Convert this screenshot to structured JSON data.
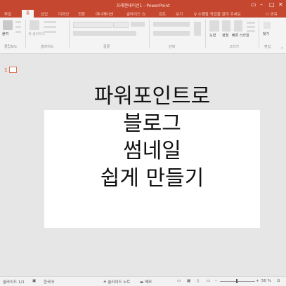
{
  "window": {
    "title": "프레젠테이션1 - PowerPoint"
  },
  "tabs": [
    "파일",
    "홈",
    "삽입",
    "디자인",
    "전환",
    "애니메이션",
    "슬라이드 쇼",
    "검토",
    "보기",
    "수행할 작업을 알려 주세요",
    "공유"
  ],
  "ribbon": {
    "paste_label": "붙여",
    "new_slide_label": "새 슬라이드",
    "groups": [
      "클립보드",
      "슬라이드",
      "글꼴",
      "단락",
      "그리기",
      "편집"
    ],
    "right_buttons": [
      "도형",
      "정렬",
      "빠른 스타일",
      "찾기"
    ]
  },
  "thumbnail": {
    "number": "1"
  },
  "slide": {
    "lines": [
      "파워포인트로",
      "블로그",
      "썸네일",
      "쉽게 만들기"
    ]
  },
  "status": {
    "slide_count": "슬라이드 1/1",
    "language": "한국어",
    "notes": "슬라이드 노트",
    "comments": "메모",
    "zoom": "50 %"
  },
  "colors": {
    "accent": "#c5472f"
  }
}
